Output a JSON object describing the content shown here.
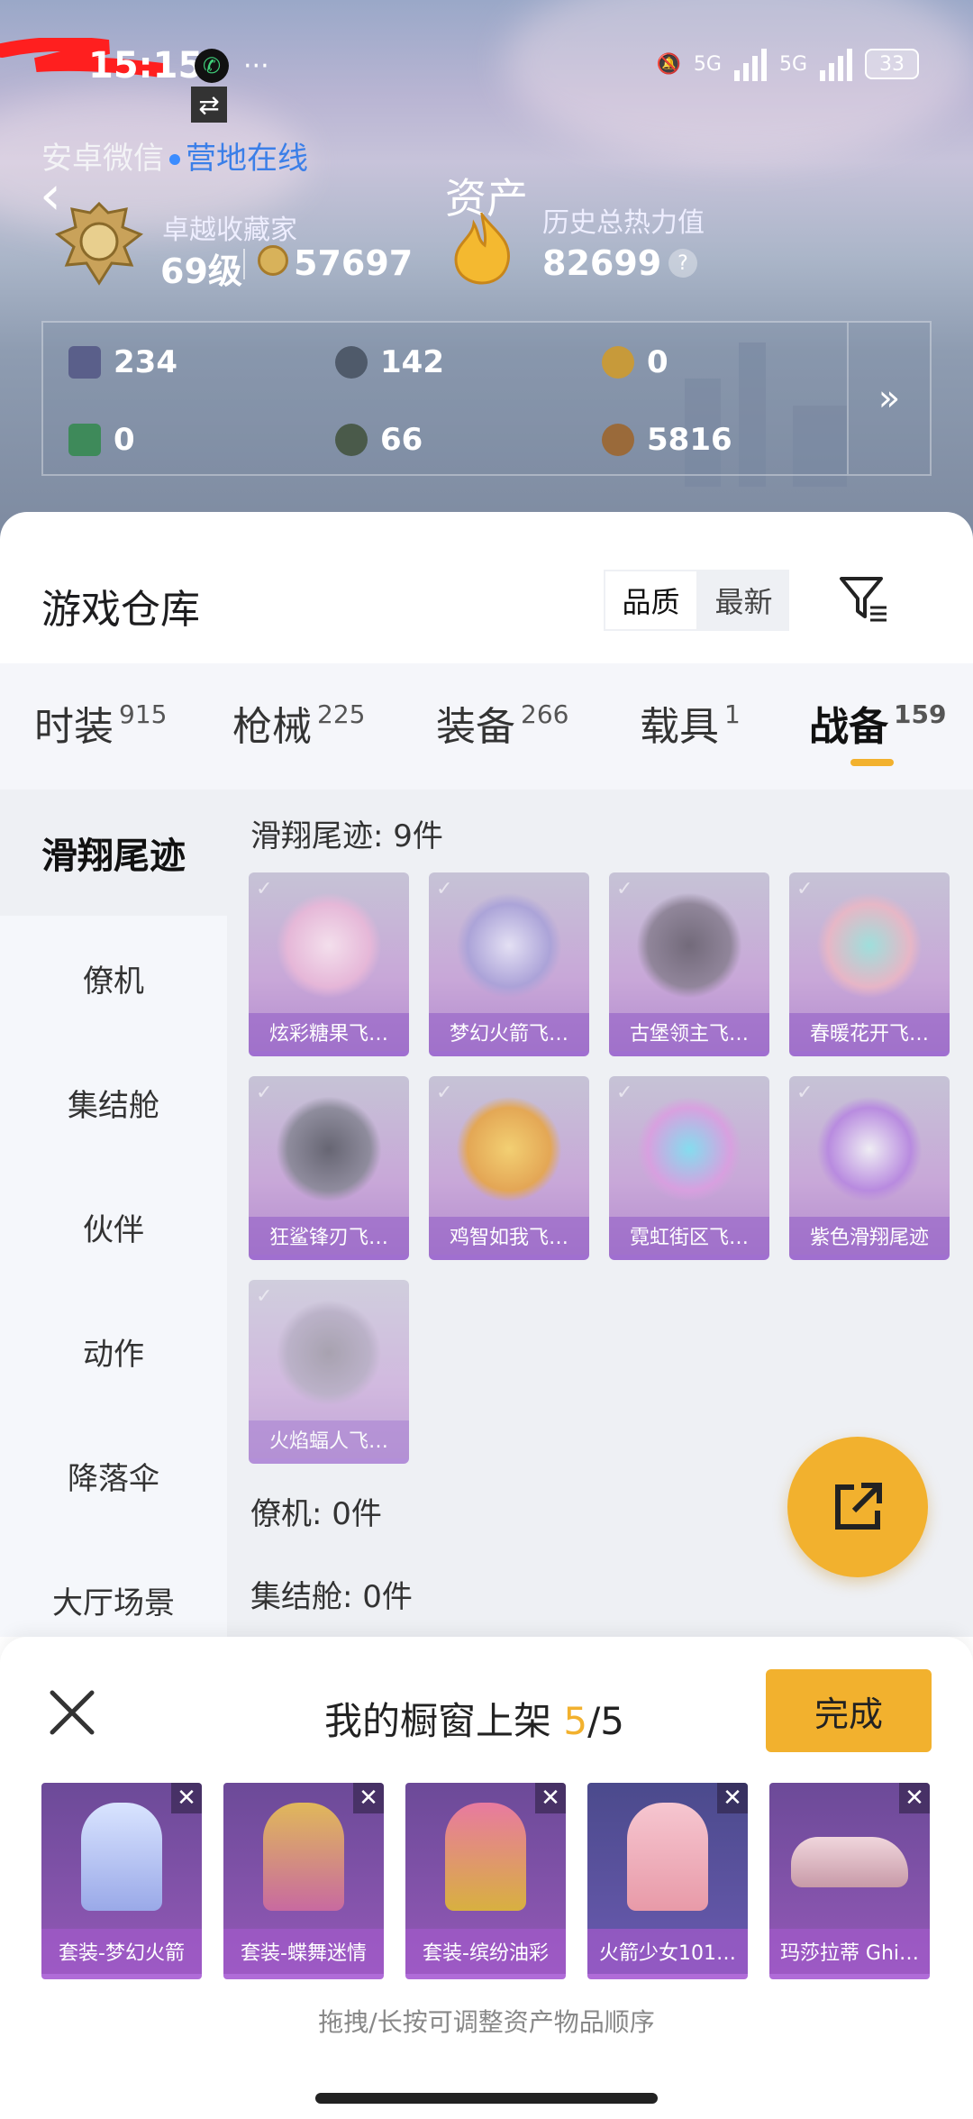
{
  "status_bar": {
    "time": "15:15",
    "network1": "5G",
    "network2": "5G",
    "battery": "33"
  },
  "header": {
    "platform": "安卓微信",
    "online_status": "营地在线",
    "rank_label": "卓越收藏家",
    "level": "69级",
    "coins": "57697",
    "assets_title": "资产",
    "history_label": "历史总热力值",
    "history_value": "82699"
  },
  "resources": [
    {
      "icon": "card-icon",
      "value": "234"
    },
    {
      "icon": "coin-silver-icon",
      "value": "142"
    },
    {
      "icon": "coin-gold-icon",
      "value": "0"
    },
    {
      "icon": "ticket-icon",
      "value": "0"
    },
    {
      "icon": "orb-icon",
      "value": "66"
    },
    {
      "icon": "bronze-coin-icon",
      "value": "5816"
    }
  ],
  "warehouse": {
    "title": "游戏仓库",
    "sort_quality": "品质",
    "sort_newest": "最新"
  },
  "tabs": [
    {
      "label": "时装",
      "count": "915"
    },
    {
      "label": "枪械",
      "count": "225"
    },
    {
      "label": "装备",
      "count": "266"
    },
    {
      "label": "载具",
      "count": "1"
    },
    {
      "label": "战备",
      "count": "159"
    }
  ],
  "sidebar": [
    "滑翔尾迹",
    "僚机",
    "集结舱",
    "伙伴",
    "动作",
    "降落伞",
    "大厅场景"
  ],
  "sections": {
    "glide_title": "滑翔尾迹: 9件",
    "wingman_title": "僚机: 0件",
    "capsule_title": "集结舱: 0件"
  },
  "items": [
    "炫彩糖果飞…",
    "梦幻火箭飞…",
    "古堡领主飞…",
    "春暖花开飞…",
    "狂鲨锋刃飞…",
    "鸡智如我飞…",
    "霓虹街区飞…",
    "紫色滑翔尾迹",
    "火焰蝠人飞…"
  ],
  "showcase": {
    "title": "我的橱窗上架",
    "count": "5",
    "total": "/5",
    "done": "完成",
    "items": [
      "套装-梦幻火箭",
      "套装-蝶舞迷情",
      "套装-缤纷油彩",
      "火箭少女101…",
      "玛莎拉蒂 Ghi…"
    ],
    "hint": "拖拽/长按可调整资产物品顺序"
  },
  "colors": {
    "accent": "#f2b12e",
    "online": "#3b7fe8",
    "card_purple": "#c8a7d8"
  }
}
